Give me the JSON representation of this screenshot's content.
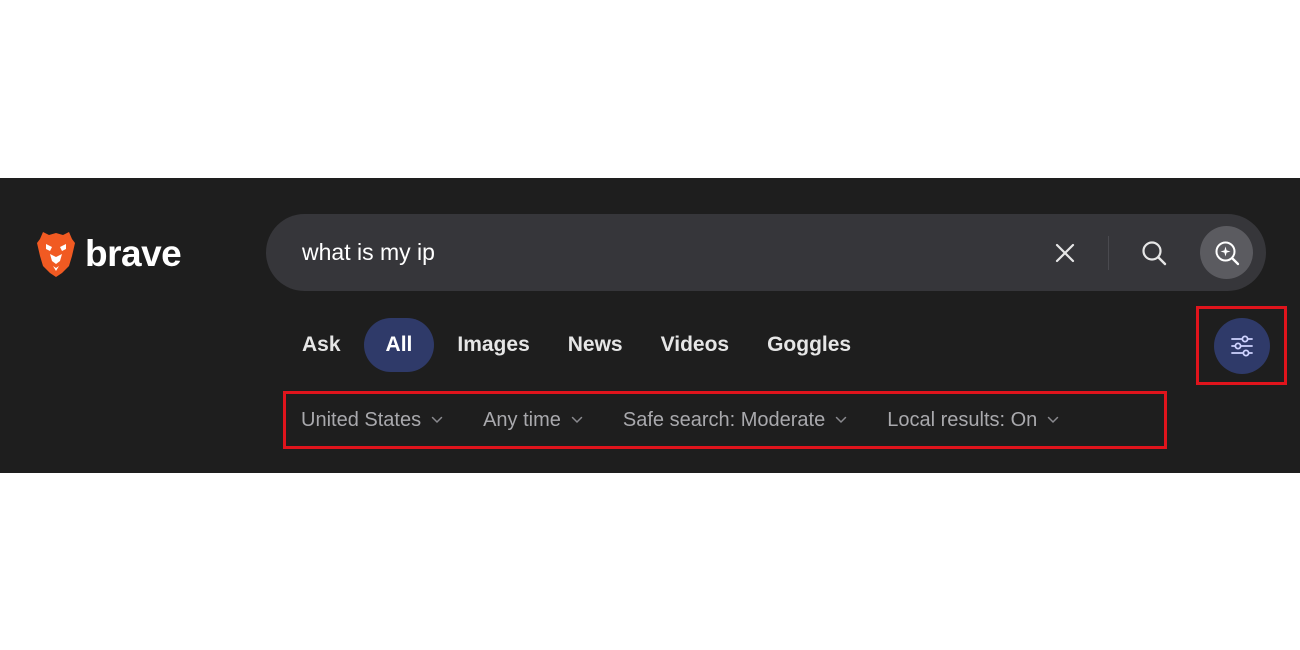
{
  "brand": {
    "name": "brave",
    "logo_icon": "brave-lion-icon",
    "logo_color": "#f15a22"
  },
  "search": {
    "query": "what is my ip",
    "clear_icon": "close-icon",
    "search_icon": "search-icon",
    "ai_icon": "ai-sparkle-search-icon"
  },
  "tabs": [
    {
      "label": "Ask",
      "active": false
    },
    {
      "label": "All",
      "active": true
    },
    {
      "label": "Images",
      "active": false
    },
    {
      "label": "News",
      "active": false
    },
    {
      "label": "Videos",
      "active": false
    },
    {
      "label": "Goggles",
      "active": false
    }
  ],
  "settings": {
    "icon": "sliders-icon"
  },
  "filters": [
    {
      "label": "United States"
    },
    {
      "label": "Any time"
    },
    {
      "label": "Safe search: Moderate"
    },
    {
      "label": "Local results: On"
    }
  ],
  "colors": {
    "header_bg": "#1e1e1e",
    "search_bg": "#36363a",
    "accent": "#2f3a69",
    "highlight": "#e0141c"
  }
}
